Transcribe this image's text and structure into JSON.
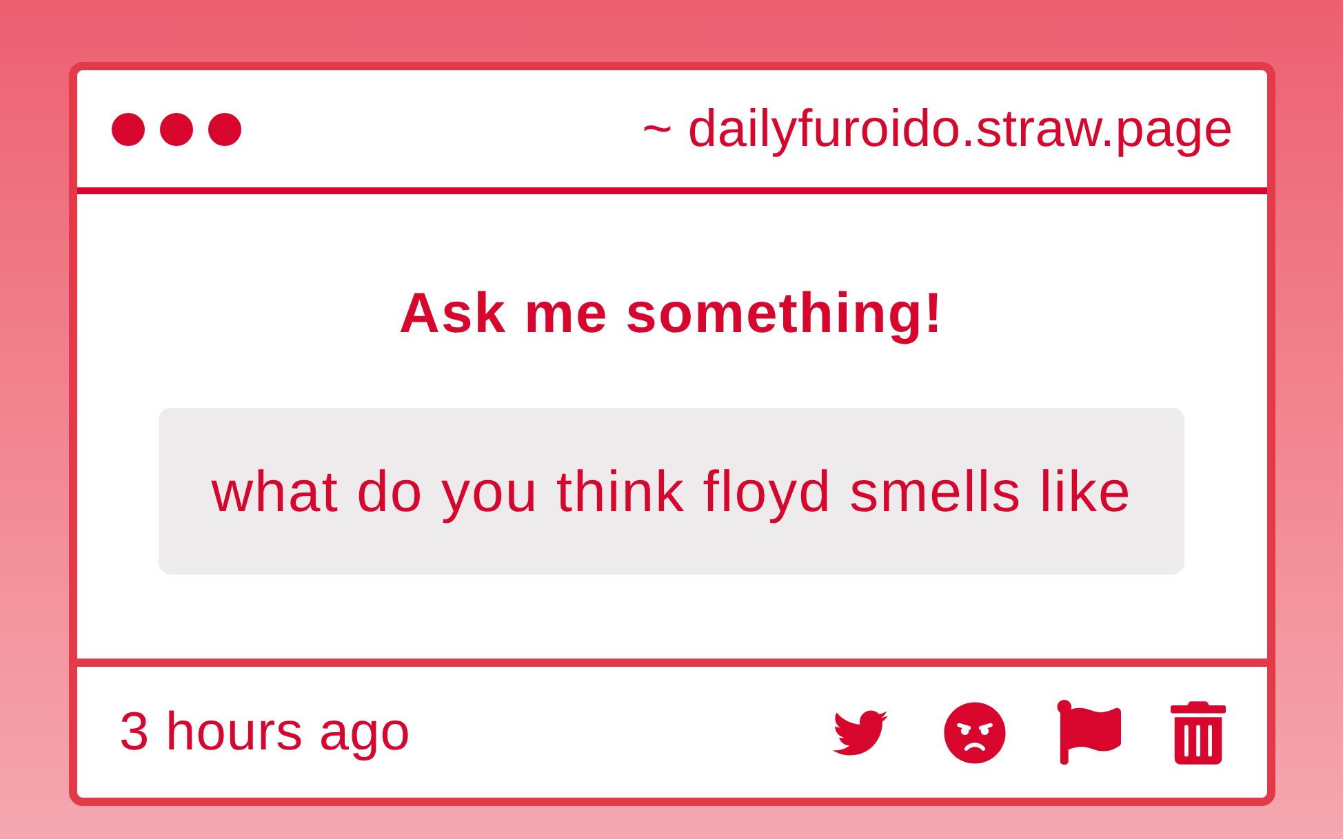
{
  "window": {
    "url": "~ dailyfuroido.straw.page"
  },
  "prompt": {
    "title": "Ask me something!",
    "question": "what do you think floyd smells like"
  },
  "footer": {
    "time": "3 hours ago"
  }
}
